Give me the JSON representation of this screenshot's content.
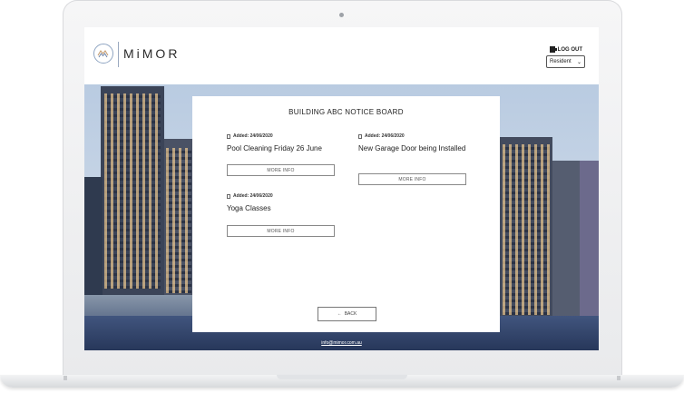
{
  "brand": {
    "name": "MiMOR",
    "accent": "#8fa5c2",
    "mark_colors": [
      "#c49a6c",
      "#6d84a8"
    ]
  },
  "header": {
    "logout_label": "LOG OUT",
    "role_select": {
      "selected": "Resident"
    }
  },
  "board": {
    "title": "BUILDING ABC NOTICE BOARD",
    "notices": [
      {
        "added": "Added: 24/06/2020",
        "title": "Pool Cleaning Friday 26 June",
        "button": "MORE INFO"
      },
      {
        "added": "Added: 24/06/2020",
        "title": "New Garage Door being Installed",
        "button": "MORE INFO"
      },
      {
        "added": "Added: 24/06/2020",
        "title": "Yoga Classes",
        "button": "MORE INFO"
      }
    ],
    "back_label": "BACK"
  },
  "footer": {
    "email": "info@mimor.com.au"
  }
}
